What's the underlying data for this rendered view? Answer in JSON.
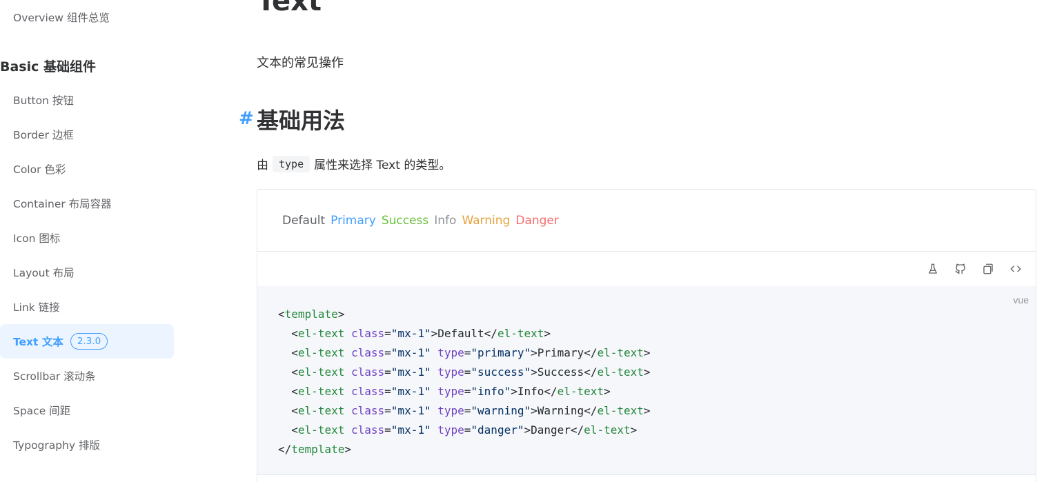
{
  "sidebar": {
    "overview": "Overview 组件总览",
    "group_title": "Basic 基础组件",
    "items": [
      {
        "label": "Button 按钮"
      },
      {
        "label": "Border 边框"
      },
      {
        "label": "Color 色彩"
      },
      {
        "label": "Container 布局容器"
      },
      {
        "label": "Icon 图标"
      },
      {
        "label": "Layout 布局"
      },
      {
        "label": "Link 链接"
      },
      {
        "label": "Text 文本",
        "badge": "2.3.0",
        "active": true
      },
      {
        "label": "Scrollbar 滚动条"
      },
      {
        "label": "Space 间距"
      },
      {
        "label": "Typography 排版"
      }
    ]
  },
  "main": {
    "title": "Text",
    "description": "文本的常见操作",
    "section": {
      "anchor": "#",
      "title": "基础用法",
      "desc_prefix": "由",
      "desc_code": "type",
      "desc_suffix": "属性来选择 Text 的类型。"
    },
    "demo": {
      "texts": [
        "Default",
        "Primary",
        "Success",
        "Info",
        "Warning",
        "Danger"
      ],
      "toolbar_icons": [
        "playground-icon",
        "github-icon",
        "copy-icon",
        "code-toggle-icon"
      ],
      "lang": "vue",
      "code": {
        "open_tag": "template",
        "close_tag": "template",
        "component": "el-text",
        "class_attr": "class",
        "class_value": "\"mx-1\"",
        "type_attr": "type",
        "lines": [
          {
            "type": null,
            "text": "Default"
          },
          {
            "type": "\"primary\"",
            "text": "Primary"
          },
          {
            "type": "\"success\"",
            "text": "Success"
          },
          {
            "type": "\"info\"",
            "text": "Info"
          },
          {
            "type": "\"warning\"",
            "text": "Warning"
          },
          {
            "type": "\"danger\"",
            "text": "Danger"
          }
        ]
      }
    }
  },
  "colors": {
    "primary": "#409eff",
    "success": "#67c23a",
    "info": "#909399",
    "warning": "#e6a23c",
    "danger": "#f56c6c",
    "default": "#606266"
  }
}
